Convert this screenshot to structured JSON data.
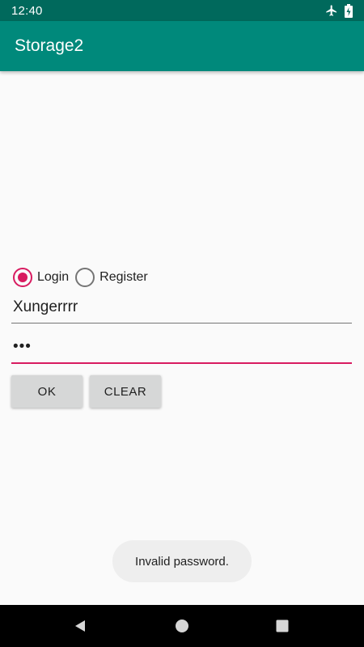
{
  "status_bar": {
    "time": "12:40",
    "icons": [
      "airplane-mode-icon",
      "battery-charging-icon"
    ]
  },
  "app_bar": {
    "title": "Storage2",
    "color": "#00897b"
  },
  "mode_options": [
    {
      "label": "Login",
      "checked": true
    },
    {
      "label": "Register",
      "checked": false
    }
  ],
  "username": {
    "value": "Xungerrrr"
  },
  "password": {
    "value": "•••"
  },
  "buttons": {
    "ok_label": "OK",
    "clear_label": "CLEAR"
  },
  "toast": {
    "message": "Invalid password."
  },
  "nav_bar": {
    "icons": [
      "back-icon",
      "home-icon",
      "recents-icon"
    ]
  },
  "colors": {
    "accent": "#d81b60",
    "status_bar": "#00695c",
    "background": "#fafafa"
  }
}
